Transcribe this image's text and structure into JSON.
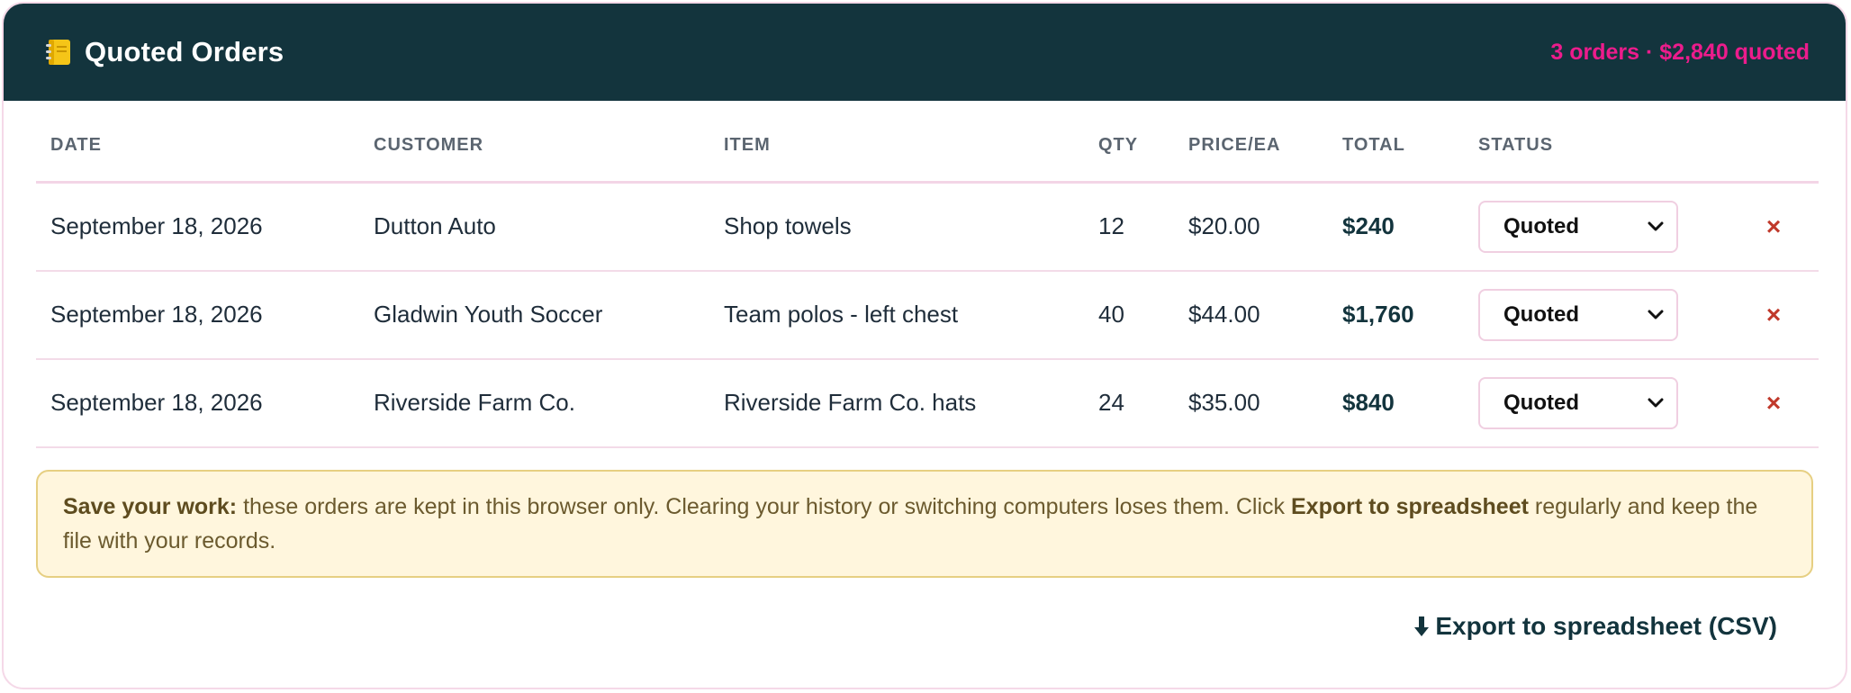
{
  "header": {
    "title": "Quoted Orders",
    "icon": "notebook-icon",
    "summary": "3 orders · $2,840 quoted"
  },
  "table": {
    "columns": [
      "DATE",
      "CUSTOMER",
      "ITEM",
      "QTY",
      "PRICE/EA",
      "TOTAL",
      "STATUS"
    ],
    "rows": [
      {
        "date": "September 18, 2026",
        "customer": "Dutton Auto",
        "item": "Shop towels",
        "qty": "12",
        "price": "$20.00",
        "total": "$240",
        "status": "Quoted",
        "delete": "×"
      },
      {
        "date": "September 18, 2026",
        "customer": "Gladwin Youth Soccer",
        "item": "Team polos - left chest",
        "qty": "40",
        "price": "$44.00",
        "total": "$1,760",
        "status": "Quoted",
        "delete": "×"
      },
      {
        "date": "September 18, 2026",
        "customer": "Riverside Farm Co.",
        "item": "Riverside Farm Co. hats",
        "qty": "24",
        "price": "$35.00",
        "total": "$840",
        "status": "Quoted",
        "delete": "×"
      }
    ]
  },
  "notice": {
    "lead": "Save your work:",
    "text1": " these orders are kept in this browser only. Clearing your history or switching computers loses them. Click ",
    "emphasis": "Export to spreadsheet",
    "text2": " regularly and keep the file with your records."
  },
  "export": {
    "label": "Export to spreadsheet (CSV)",
    "icon": "down-arrow-icon"
  },
  "colors": {
    "header_bg": "#13343d",
    "accent": "#ec1c8c",
    "notice_bg": "#fff6dd",
    "delete": "#c0392b"
  }
}
